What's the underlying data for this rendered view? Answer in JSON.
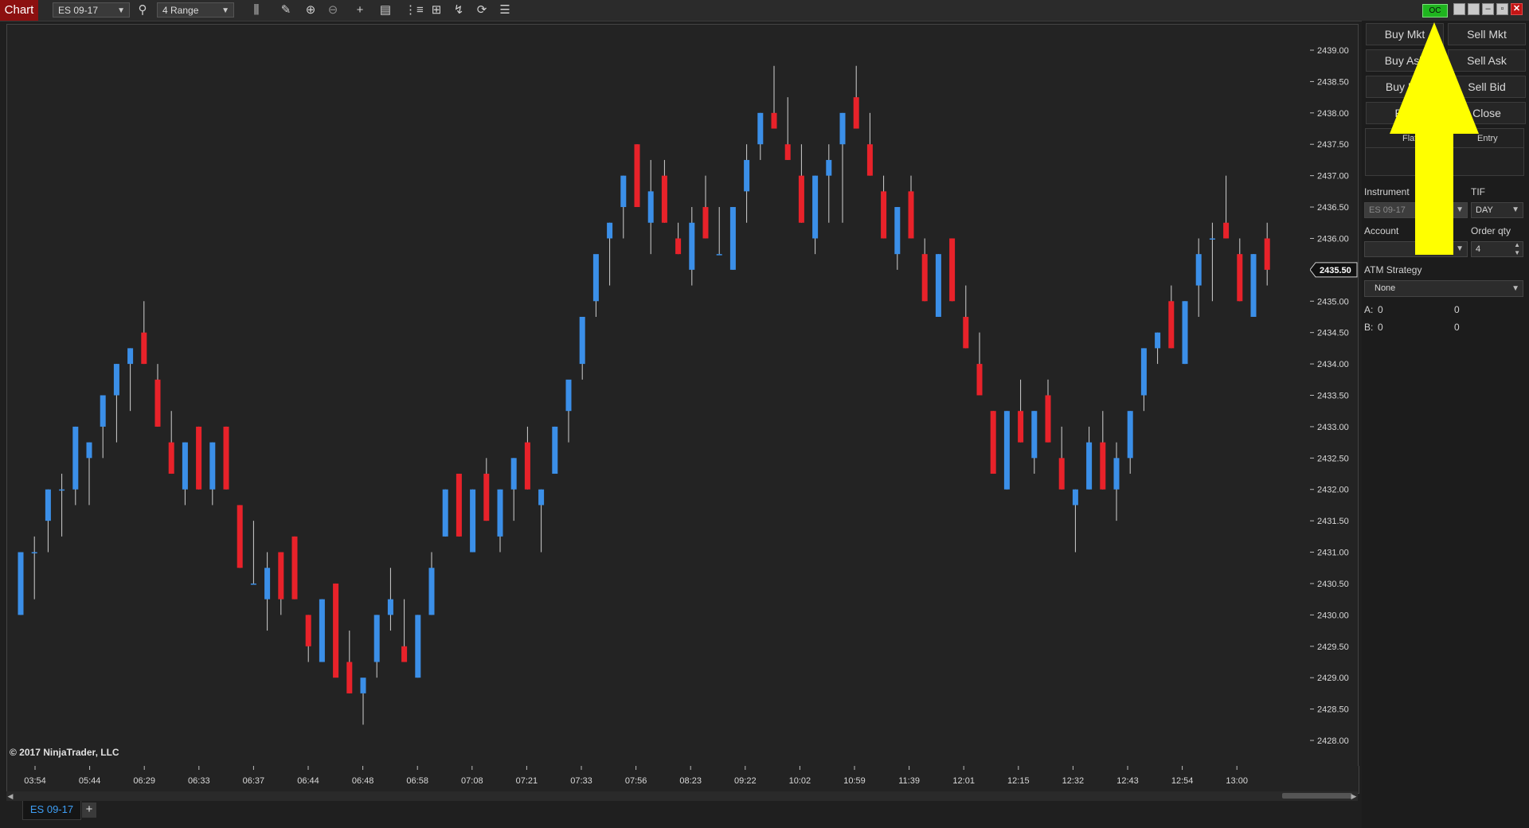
{
  "toolbar": {
    "chart_label": "Chart",
    "instrument": "ES 09-17",
    "bar_type": "4 Range",
    "connection_status": "OC"
  },
  "chart": {
    "copyright": "© 2017 NinjaTrader, LLC",
    "current_price": "2435.50",
    "colors": {
      "up": "#3b8fe8",
      "down": "#e8222a",
      "background": "#232323"
    }
  },
  "chart_data": {
    "type": "candlestick",
    "ylim": [
      2427.75,
      2439.5
    ],
    "price_ticks": [
      "2439.00",
      "2438.50",
      "2438.00",
      "2437.50",
      "2437.00",
      "2436.50",
      "2436.00",
      "2435.50",
      "2435.00",
      "2434.50",
      "2434.00",
      "2433.50",
      "2433.00",
      "2432.50",
      "2432.00",
      "2431.50",
      "2431.00",
      "2430.50",
      "2430.00",
      "2429.50",
      "2429.00",
      "2428.50",
      "2428.00"
    ],
    "time_ticks": [
      "03:54",
      "05:44",
      "06:29",
      "06:33",
      "06:37",
      "06:44",
      "06:48",
      "06:58",
      "07:08",
      "07:21",
      "07:33",
      "07:56",
      "08:23",
      "09:22",
      "10:02",
      "10:59",
      "11:39",
      "12:01",
      "12:15",
      "12:32",
      "12:43",
      "12:54",
      "13:00"
    ],
    "candles": [
      {
        "open": 2430.0,
        "high": 2431.0,
        "low": 2430.0,
        "close": 2431.0
      },
      {
        "open": 2431.0,
        "high": 2431.25,
        "low": 2430.25,
        "close": 2431.0
      },
      {
        "open": 2431.5,
        "high": 2432.0,
        "low": 2431.0,
        "close": 2432.0
      },
      {
        "open": 2432.0,
        "high": 2432.25,
        "low": 2431.25,
        "close": 2432.0
      },
      {
        "open": 2432.0,
        "high": 2433.0,
        "low": 2431.75,
        "close": 2433.0
      },
      {
        "open": 2432.5,
        "high": 2432.75,
        "low": 2431.75,
        "close": 2432.75
      },
      {
        "open": 2433.0,
        "high": 2433.5,
        "low": 2432.5,
        "close": 2433.5
      },
      {
        "open": 2433.5,
        "high": 2434.0,
        "low": 2432.75,
        "close": 2434.0
      },
      {
        "open": 2434.0,
        "high": 2434.25,
        "low": 2433.25,
        "close": 2434.25
      },
      {
        "open": 2434.5,
        "high": 2435.0,
        "low": 2434.0,
        "close": 2434.0
      },
      {
        "open": 2433.75,
        "high": 2434.0,
        "low": 2433.0,
        "close": 2433.0
      },
      {
        "open": 2432.75,
        "high": 2433.25,
        "low": 2432.25,
        "close": 2432.25
      },
      {
        "open": 2432.0,
        "high": 2432.75,
        "low": 2431.75,
        "close": 2432.75
      },
      {
        "open": 2433.0,
        "high": 2433.0,
        "low": 2432.0,
        "close": 2432.0
      },
      {
        "open": 2432.0,
        "high": 2432.75,
        "low": 2431.75,
        "close": 2432.75
      },
      {
        "open": 2433.0,
        "high": 2433.0,
        "low": 2432.0,
        "close": 2432.0
      },
      {
        "open": 2431.75,
        "high": 2431.75,
        "low": 2430.75,
        "close": 2430.75
      },
      {
        "open": 2430.5,
        "high": 2431.5,
        "low": 2430.5,
        "close": 2430.5
      },
      {
        "open": 2430.25,
        "high": 2431.0,
        "low": 2429.75,
        "close": 2430.75
      },
      {
        "open": 2431.0,
        "high": 2431.0,
        "low": 2430.0,
        "close": 2430.25
      },
      {
        "open": 2431.25,
        "high": 2431.25,
        "low": 2430.25,
        "close": 2430.25
      },
      {
        "open": 2430.0,
        "high": 2430.0,
        "low": 2429.25,
        "close": 2429.5
      },
      {
        "open": 2429.25,
        "high": 2430.25,
        "low": 2429.25,
        "close": 2430.25
      },
      {
        "open": 2430.5,
        "high": 2430.5,
        "low": 2429.25,
        "close": 2429.0
      },
      {
        "open": 2429.25,
        "high": 2429.75,
        "low": 2428.75,
        "close": 2428.75
      },
      {
        "open": 2428.75,
        "high": 2428.75,
        "low": 2428.25,
        "close": 2429.0
      },
      {
        "open": 2429.25,
        "high": 2430.0,
        "low": 2429.0,
        "close": 2430.0
      },
      {
        "open": 2430.0,
        "high": 2430.75,
        "low": 2429.75,
        "close": 2430.25
      },
      {
        "open": 2429.5,
        "high": 2430.25,
        "low": 2429.25,
        "close": 2429.25
      },
      {
        "open": 2429.0,
        "high": 2430.0,
        "low": 2429.0,
        "close": 2430.0
      },
      {
        "open": 2430.0,
        "high": 2431.0,
        "low": 2430.0,
        "close": 2430.75
      },
      {
        "open": 2431.25,
        "high": 2432.0,
        "low": 2431.25,
        "close": 2432.0
      },
      {
        "open": 2432.25,
        "high": 2432.25,
        "low": 2431.25,
        "close": 2431.25
      },
      {
        "open": 2431.0,
        "high": 2432.0,
        "low": 2431.0,
        "close": 2432.0
      },
      {
        "open": 2432.25,
        "high": 2432.5,
        "low": 2431.5,
        "close": 2431.5
      },
      {
        "open": 2431.25,
        "high": 2432.0,
        "low": 2431.0,
        "close": 2432.0
      },
      {
        "open": 2432.0,
        "high": 2432.5,
        "low": 2431.5,
        "close": 2432.5
      },
      {
        "open": 2432.75,
        "high": 2433.0,
        "low": 2432.0,
        "close": 2432.0
      },
      {
        "open": 2431.75,
        "high": 2432.0,
        "low": 2431.0,
        "close": 2432.0
      },
      {
        "open": 2432.25,
        "high": 2433.0,
        "low": 2432.25,
        "close": 2433.0
      },
      {
        "open": 2433.25,
        "high": 2433.5,
        "low": 2432.75,
        "close": 2433.75
      },
      {
        "open": 2434.0,
        "high": 2434.0,
        "low": 2433.75,
        "close": 2434.75
      },
      {
        "open": 2435.0,
        "high": 2435.25,
        "low": 2434.75,
        "close": 2435.75
      },
      {
        "open": 2436.0,
        "high": 2436.25,
        "low": 2435.25,
        "close": 2436.25
      },
      {
        "open": 2436.5,
        "high": 2437.0,
        "low": 2436.0,
        "close": 2437.0
      },
      {
        "open": 2437.5,
        "high": 2437.5,
        "low": 2436.5,
        "close": 2436.5
      },
      {
        "open": 2436.25,
        "high": 2437.25,
        "low": 2435.75,
        "close": 2436.75
      },
      {
        "open": 2437.0,
        "high": 2437.25,
        "low": 2436.25,
        "close": 2436.25
      },
      {
        "open": 2436.0,
        "high": 2436.25,
        "low": 2435.75,
        "close": 2435.75
      },
      {
        "open": 2435.5,
        "high": 2436.5,
        "low": 2435.25,
        "close": 2436.25
      },
      {
        "open": 2436.5,
        "high": 2437.0,
        "low": 2436.0,
        "close": 2436.0
      },
      {
        "open": 2435.75,
        "high": 2436.5,
        "low": 2435.75,
        "close": 2435.75
      },
      {
        "open": 2435.5,
        "high": 2436.5,
        "low": 2435.5,
        "close": 2436.5
      },
      {
        "open": 2436.75,
        "high": 2437.5,
        "low": 2436.25,
        "close": 2437.25
      },
      {
        "open": 2437.5,
        "high": 2438.0,
        "low": 2437.25,
        "close": 2438.0
      },
      {
        "open": 2438.0,
        "high": 2438.75,
        "low": 2437.75,
        "close": 2437.75
      },
      {
        "open": 2437.5,
        "high": 2438.25,
        "low": 2437.25,
        "close": 2437.25
      },
      {
        "open": 2437.0,
        "high": 2437.5,
        "low": 2436.25,
        "close": 2436.25
      },
      {
        "open": 2436.0,
        "high": 2437.0,
        "low": 2435.75,
        "close": 2437.0
      },
      {
        "open": 2437.0,
        "high": 2437.5,
        "low": 2436.25,
        "close": 2437.25
      },
      {
        "open": 2437.5,
        "high": 2438.0,
        "low": 2436.25,
        "close": 2438.0
      },
      {
        "open": 2438.25,
        "high": 2438.75,
        "low": 2437.75,
        "close": 2437.75
      },
      {
        "open": 2437.5,
        "high": 2438.0,
        "low": 2437.0,
        "close": 2437.0
      },
      {
        "open": 2436.75,
        "high": 2437.0,
        "low": 2436.0,
        "close": 2436.0
      },
      {
        "open": 2435.75,
        "high": 2436.5,
        "low": 2435.5,
        "close": 2436.5
      },
      {
        "open": 2436.75,
        "high": 2437.0,
        "low": 2436.0,
        "close": 2436.0
      },
      {
        "open": 2435.75,
        "high": 2436.0,
        "low": 2435.0,
        "close": 2435.0
      },
      {
        "open": 2434.75,
        "high": 2435.75,
        "low": 2434.75,
        "close": 2435.75
      },
      {
        "open": 2436.0,
        "high": 2436.0,
        "low": 2435.0,
        "close": 2435.0
      },
      {
        "open": 2434.75,
        "high": 2435.25,
        "low": 2434.25,
        "close": 2434.25
      },
      {
        "open": 2434.0,
        "high": 2434.5,
        "low": 2433.5,
        "close": 2433.5
      },
      {
        "open": 2433.25,
        "high": 2433.25,
        "low": 2432.25,
        "close": 2432.25
      },
      {
        "open": 2432.0,
        "high": 2433.25,
        "low": 2432.0,
        "close": 2433.25
      },
      {
        "open": 2433.25,
        "high": 2433.75,
        "low": 2432.75,
        "close": 2432.75
      },
      {
        "open": 2432.5,
        "high": 2433.25,
        "low": 2432.25,
        "close": 2433.25
      },
      {
        "open": 2433.5,
        "high": 2433.75,
        "low": 2432.75,
        "close": 2432.75
      },
      {
        "open": 2432.5,
        "high": 2433.0,
        "low": 2432.0,
        "close": 2432.0
      },
      {
        "open": 2431.75,
        "high": 2432.0,
        "low": 2431.0,
        "close": 2432.0
      },
      {
        "open": 2432.0,
        "high": 2433.0,
        "low": 2432.0,
        "close": 2432.75
      },
      {
        "open": 2432.75,
        "high": 2433.25,
        "low": 2432.0,
        "close": 2432.0
      },
      {
        "open": 2432.0,
        "high": 2432.75,
        "low": 2431.5,
        "close": 2432.5
      },
      {
        "open": 2432.5,
        "high": 2433.25,
        "low": 2432.25,
        "close": 2433.25
      },
      {
        "open": 2433.5,
        "high": 2434.25,
        "low": 2433.25,
        "close": 2434.25
      },
      {
        "open": 2434.25,
        "high": 2434.5,
        "low": 2434.0,
        "close": 2434.5
      },
      {
        "open": 2435.0,
        "high": 2435.25,
        "low": 2434.25,
        "close": 2434.25
      },
      {
        "open": 2434.0,
        "high": 2435.0,
        "low": 2434.0,
        "close": 2435.0
      },
      {
        "open": 2435.25,
        "high": 2436.0,
        "low": 2434.75,
        "close": 2435.75
      },
      {
        "open": 2436.0,
        "high": 2436.25,
        "low": 2435.0,
        "close": 2436.0
      },
      {
        "open": 2436.25,
        "high": 2437.0,
        "low": 2436.0,
        "close": 2436.0
      },
      {
        "open": 2435.75,
        "high": 2436.0,
        "low": 2435.0,
        "close": 2435.0
      },
      {
        "open": 2434.75,
        "high": 2435.75,
        "low": 2434.75,
        "close": 2435.75
      },
      {
        "open": 2436.0,
        "high": 2436.25,
        "low": 2435.25,
        "close": 2435.5
      }
    ]
  },
  "bottom": {
    "tab_label": "ES 09-17",
    "add_tab": "+"
  },
  "chart_trader": {
    "buttons": {
      "buy_mkt": "Buy Mkt",
      "sell_mkt": "Sell Mkt",
      "buy_ask": "Buy Ask",
      "sell_ask": "Sell Ask",
      "buy_bid": "Buy Bid",
      "sell_bid": "Sell Bid",
      "rev": "Rev",
      "close": "Close"
    },
    "position": {
      "flat": "Flat",
      "entry": "Entry"
    },
    "instrument_label": "Instrument",
    "instrument_value": "ES 09-17",
    "tif_label": "TIF",
    "tif_value": "DAY",
    "account_label": "Account",
    "account_value": "",
    "order_qty_label": "Order qty",
    "order_qty_value": "4",
    "atm_label": "ATM Strategy",
    "atm_value": "None",
    "a_label": "A:",
    "a_value": "0",
    "a_value2": "0",
    "b_label": "B:",
    "b_value": "0",
    "b_value2": "0"
  },
  "annotation": {
    "arrow_color": "#ffff00"
  }
}
